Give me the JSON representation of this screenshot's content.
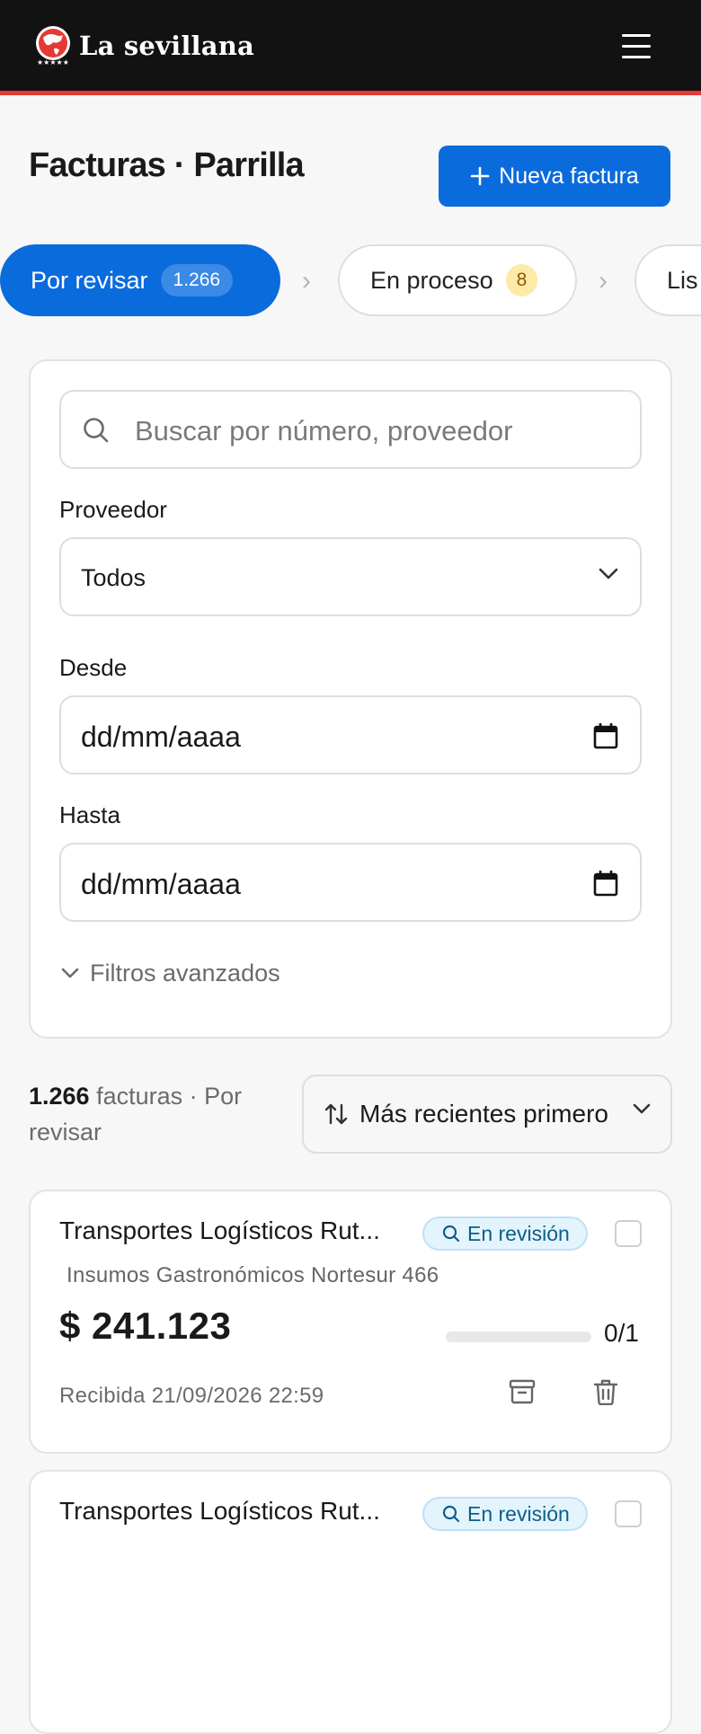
{
  "header": {
    "brand": "La sevillana",
    "logo_icon": "globe-logo-icon",
    "menu_icon": "hamburger-menu-icon"
  },
  "page": {
    "title": "Facturas · Parrilla",
    "new_button": "Nueva factura"
  },
  "tabs": [
    {
      "label": "Por revisar",
      "count": "1.266",
      "active": true
    },
    {
      "label": "En proceso",
      "count": "8",
      "active": false
    },
    {
      "label": "Lis",
      "active": false
    }
  ],
  "filters": {
    "search_placeholder": "Buscar por número, proveedor",
    "provider_label": "Proveedor",
    "provider_value": "Todos",
    "from_label": "Desde",
    "from_value": "dd/mm/aaaa",
    "to_label": "Hasta",
    "to_value": "dd/mm/aaaa",
    "advanced_label": "Filtros avanzados"
  },
  "results": {
    "count": "1.266",
    "suffix": "facturas · Por revisar",
    "sort_label": "Más recientes primero"
  },
  "invoices": [
    {
      "title": "Transportes Logísticos Rut...",
      "status": "En revisión",
      "subtitle": "Insumos Gastronómicos Nortesur 466",
      "amount": "$ 241.123",
      "progress_label": "0/1",
      "progress_fraction": 0,
      "received": "Recibida 21/09/2026 22:59"
    },
    {
      "title": "Transportes Logísticos Rut...",
      "status": "En revisión"
    }
  ],
  "colors": {
    "primary": "#0a6bdc",
    "header_bg": "#121212",
    "header_accent": "#e53935",
    "status_bg": "#e4f4fd"
  }
}
